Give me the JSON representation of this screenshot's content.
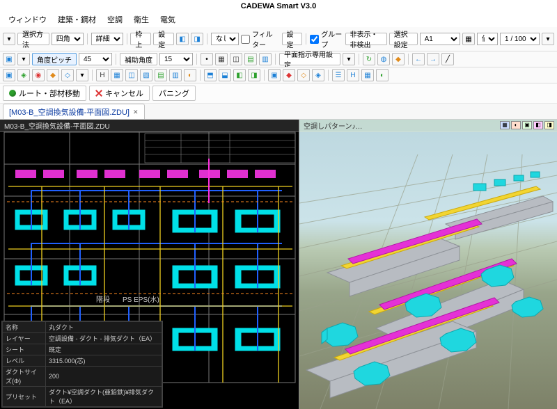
{
  "app": {
    "title": "CADEWA Smart V3.0"
  },
  "menu": [
    "ウィンドウ",
    "建築・鋼材",
    "空調",
    "衛生",
    "電気"
  ],
  "tb1": {
    "selmethod_label": "選択方法",
    "selmethod_value": "四角",
    "detail": "詳細",
    "wakugami": "枠上",
    "settei": "設定",
    "none": "なし",
    "filter": "フィルター",
    "settei2": "設定",
    "group": "グループ",
    "hihyouji": "非表示・非検出",
    "sentaku": "選択設定",
    "layer": "A1",
    "value": "値",
    "scale": "1 / 100"
  },
  "tb2": {
    "kakudo_pitch": "角度ピッチ",
    "kakudo_pitch_val": "45",
    "hojo_kakudo": "補助角度",
    "hojo_kakudo_val": "15",
    "heimen": "平面指示専用設定"
  },
  "cmd": {
    "route": "ルート・部材移動",
    "cancel": "キャンセル",
    "panning": "パニング"
  },
  "tab": {
    "name": "[M03-B_空調換気設備-平面図.ZDU]"
  },
  "pane2d": {
    "title": "M03-B_空調換気設備-平面図.ZDU",
    "label_floor": "階段",
    "label_ps": "PS  EPS(水)"
  },
  "pane3d": {
    "title": "空調しパターン♪…"
  },
  "props": {
    "rows": [
      [
        "名称",
        "丸ダクト"
      ],
      [
        "レイヤー",
        "空調設備 - ダクト - 排気ダクト（EA）"
      ],
      [
        "シート",
        "既定"
      ],
      [
        "レベル",
        "3315.000(芯)"
      ],
      [
        "ダクトサイズ(Φ)",
        "200"
      ],
      [
        "プリセット",
        "ダクト¥空調ダクト(亜鉛鉄)¥排気ダクト（EA）"
      ]
    ]
  }
}
